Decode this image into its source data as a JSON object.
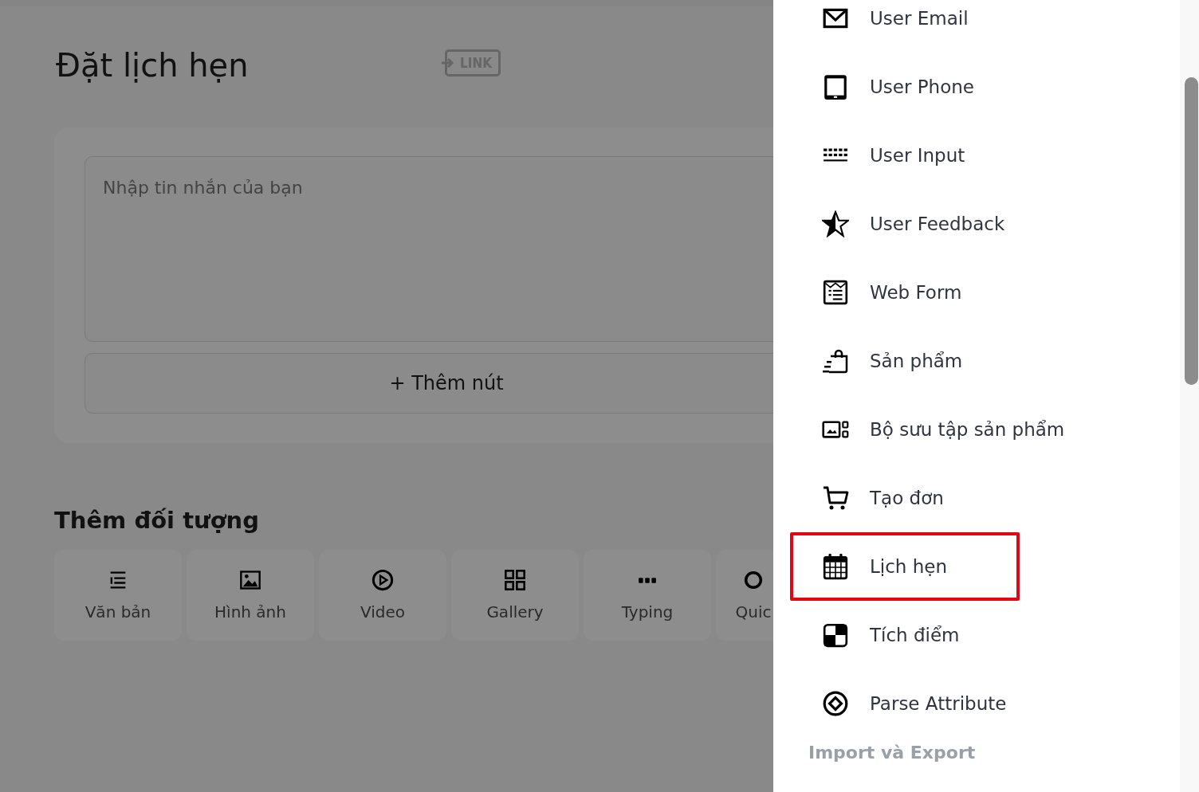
{
  "editor": {
    "title": "Đặt lịch hẹn",
    "link_badge": "LINK",
    "message": {
      "placeholder": "Nhập tin nhắn của bạn"
    },
    "add_button": "+ Thêm nút"
  },
  "objects": {
    "heading": "Thêm đối tượng",
    "tiles": [
      {
        "kind": "text",
        "label": "Văn bản"
      },
      {
        "kind": "image",
        "label": "Hình ảnh"
      },
      {
        "kind": "video",
        "label": "Video"
      },
      {
        "kind": "gallery",
        "label": "Gallery"
      },
      {
        "kind": "typing",
        "label": "Typing"
      },
      {
        "kind": "quick",
        "label": "Quic"
      }
    ]
  },
  "panel": {
    "items": [
      {
        "kind": "email",
        "label": "User Email",
        "highlighted": false
      },
      {
        "kind": "phone",
        "label": "User Phone",
        "highlighted": false
      },
      {
        "kind": "input",
        "label": "User Input",
        "highlighted": false
      },
      {
        "kind": "feedback",
        "label": "User Feedback",
        "highlighted": false
      },
      {
        "kind": "webform",
        "label": "Web Form",
        "highlighted": false
      },
      {
        "kind": "product",
        "label": "Sản phẩm",
        "highlighted": false
      },
      {
        "kind": "collection",
        "label": "Bộ sưu tập sản phẩm",
        "highlighted": false
      },
      {
        "kind": "order",
        "label": "Tạo đơn",
        "highlighted": false
      },
      {
        "kind": "appointment",
        "label": "Lịch hẹn",
        "highlighted": true
      },
      {
        "kind": "points",
        "label": "Tích điểm",
        "highlighted": false
      },
      {
        "kind": "attribute",
        "label": "Parse Attribute",
        "highlighted": false
      }
    ],
    "section": "Import và Export"
  }
}
